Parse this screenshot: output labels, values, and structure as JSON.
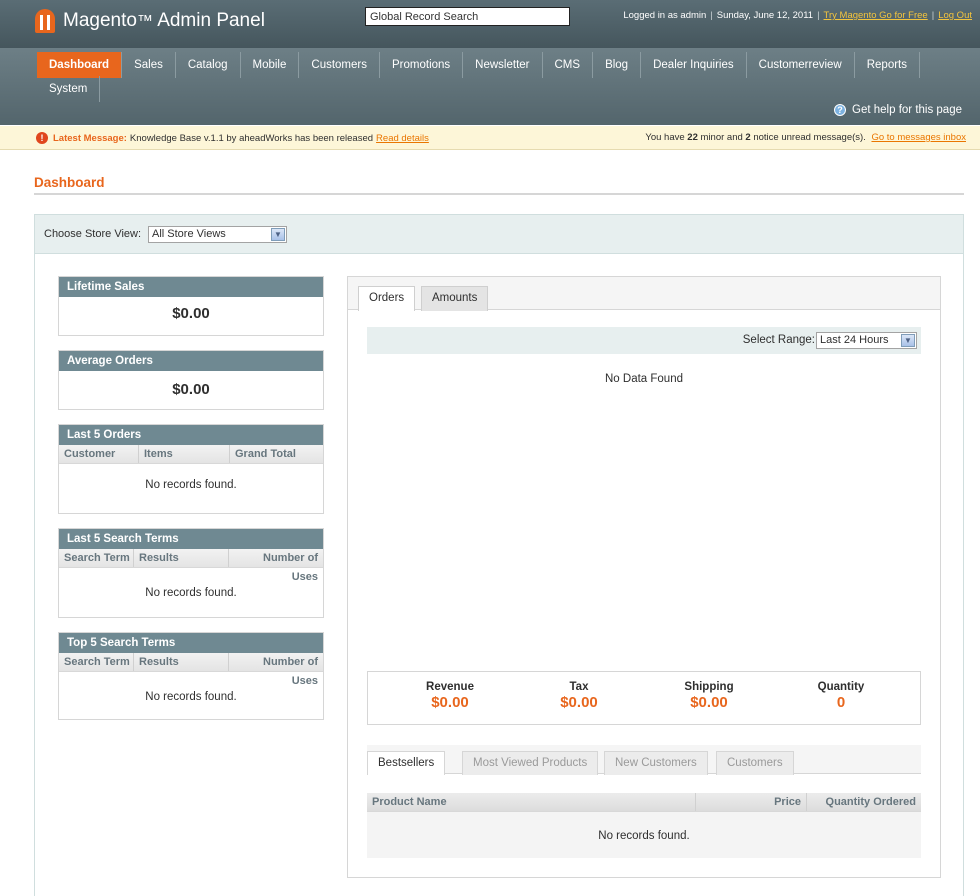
{
  "header": {
    "logo_main": "Magento",
    "logo_sub": "Admin Panel",
    "search_value": "Global Record Search",
    "logged_in": "Logged in as admin",
    "date": "Sunday, June 12, 2011",
    "try_link": "Try Magento Go for Free",
    "logout_link": "Log Out"
  },
  "nav": {
    "row1": [
      "Dashboard",
      "Sales",
      "Catalog",
      "Mobile",
      "Customers",
      "Promotions",
      "Newsletter",
      "CMS",
      "Blog",
      "Dealer Inquiries",
      "Customerreview",
      "Reports"
    ],
    "row2": [
      "System"
    ],
    "help": "Get help for this page"
  },
  "message": {
    "label": "Latest Message:",
    "text": "Knowledge Base v.1.1 by aheadWorks has been released",
    "link": "Read details",
    "right_prefix": "You have",
    "minor_count": "22",
    "mid": "minor and",
    "notice_count": "2",
    "suffix": "notice unread message(s).",
    "right_link": "Go to messages inbox"
  },
  "page_title": "Dashboard",
  "store_switcher": {
    "label": "Choose Store View:",
    "value": "All Store Views"
  },
  "lifetime_sales": {
    "title": "Lifetime Sales",
    "value": "$0.00"
  },
  "average_orders": {
    "title": "Average Orders",
    "value": "$0.00"
  },
  "last_orders": {
    "title": "Last 5 Orders",
    "columns": [
      "Customer",
      "Items",
      "Grand Total"
    ],
    "empty": "No records found."
  },
  "last_search": {
    "title": "Last 5 Search Terms",
    "columns": [
      "Search Term",
      "Results",
      "Number of Uses"
    ],
    "empty": "No records found."
  },
  "top_search": {
    "title": "Top 5 Search Terms",
    "columns": [
      "Search Term",
      "Results",
      "Number of Uses"
    ],
    "empty": "No records found."
  },
  "chart_panel": {
    "tabs": [
      "Orders",
      "Amounts"
    ],
    "range_label": "Select Range:",
    "range_value": "Last 24 Hours",
    "no_data": "No Data Found"
  },
  "totals": {
    "revenue_label": "Revenue",
    "revenue": "$0.00",
    "tax_label": "Tax",
    "tax": "$0.00",
    "shipping_label": "Shipping",
    "shipping": "$0.00",
    "quantity_label": "Quantity",
    "quantity": "0"
  },
  "bottom_tabs": [
    "Bestsellers",
    "Most Viewed Products",
    "New Customers",
    "Customers"
  ],
  "products_grid": {
    "columns": [
      "Product Name",
      "Price",
      "Quantity Ordered"
    ],
    "empty": "No records found."
  },
  "colors": {
    "accent": "#e8661d",
    "header": "#45565d",
    "box_head": "#6f8992"
  },
  "icons": {
    "logo": "magento-logo-icon",
    "help": "help-icon",
    "alert": "alert-icon",
    "dropdown": "chevron-down-icon"
  }
}
